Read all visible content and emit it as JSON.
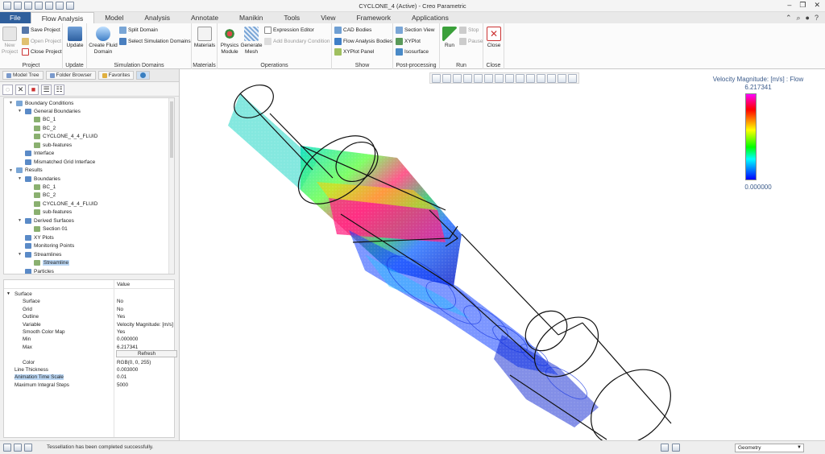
{
  "window": {
    "title": "CYCLONE_4 (Active) - Creo Parametric"
  },
  "tabs": [
    "File",
    "Flow Analysis",
    "Model",
    "Analysis",
    "Annotate",
    "Manikin",
    "Tools",
    "View",
    "Framework",
    "Applications"
  ],
  "active_tab": "Flow Analysis",
  "ribbon": {
    "project": {
      "label": "Project",
      "new": "New Project",
      "save": "Save Project",
      "open": "Open Project",
      "close": "Close Project"
    },
    "update": {
      "label": "Update",
      "button": "Update"
    },
    "simulation_domains": {
      "label": "Simulation Domains",
      "create_fluid": "Create Fluid Domain",
      "split": "Split Domain",
      "select": "Select Simulation Domains"
    },
    "materials": {
      "label": "Materials",
      "button": "Materials"
    },
    "operations": {
      "label": "Operations",
      "physics": "Physics Module",
      "mesh": "Generate Mesh",
      "expr": "Expression Editor",
      "add_bc": "Add Boundary Condition"
    },
    "show": {
      "label": "Show",
      "cad": "CAD Bodies",
      "fab": "Flow Analysis Bodies",
      "xyplot_panel": "XYPlot Panel"
    },
    "post": {
      "label": "Post-processing",
      "section_view": "Section View",
      "xyplot": "XYPlot",
      "isosurface": "Isosurface"
    },
    "run": {
      "label": "Run",
      "run": "Run",
      "stop": "Stop",
      "pause": "Pause"
    },
    "close": {
      "label": "Close",
      "button": "Close"
    }
  },
  "nav_tabs": [
    "Model Tree",
    "Folder Browser",
    "Favorites"
  ],
  "tree": [
    {
      "label": "Boundary Conditions",
      "level": 1,
      "exp": "-"
    },
    {
      "label": "General Boundaries",
      "level": 2,
      "exp": "-"
    },
    {
      "label": "BC_1",
      "level": 3,
      "exp": ""
    },
    {
      "label": "BC_2",
      "level": 3,
      "exp": ""
    },
    {
      "label": "CYCLONE_4_4_FLUID",
      "level": 3,
      "exp": ""
    },
    {
      "label": "sub-features",
      "level": 3,
      "exp": ""
    },
    {
      "label": "Interface",
      "level": 2,
      "exp": ""
    },
    {
      "label": "Mismatched Grid Interface",
      "level": 2,
      "exp": ""
    },
    {
      "label": "Results",
      "level": 1,
      "exp": "-"
    },
    {
      "label": "Boundaries",
      "level": 2,
      "exp": "-"
    },
    {
      "label": "BC_1",
      "level": 3,
      "exp": ""
    },
    {
      "label": "BC_2",
      "level": 3,
      "exp": ""
    },
    {
      "label": "CYCLONE_4_4_FLUID",
      "level": 3,
      "exp": ""
    },
    {
      "label": "sub-features",
      "level": 3,
      "exp": ""
    },
    {
      "label": "Derived Surfaces",
      "level": 2,
      "exp": "-"
    },
    {
      "label": "Section 01",
      "level": 3,
      "exp": ""
    },
    {
      "label": "XY Plots",
      "level": 2,
      "exp": ""
    },
    {
      "label": "Monitoring Points",
      "level": 2,
      "exp": ""
    },
    {
      "label": "Streamlines",
      "level": 2,
      "exp": "-"
    },
    {
      "label": "Streamline",
      "level": 3,
      "exp": "",
      "selected": true
    },
    {
      "label": "Particles",
      "level": 2,
      "exp": ""
    }
  ],
  "props": {
    "header": "Value",
    "rows": [
      {
        "k": "Surface",
        "v": "",
        "indent": 0,
        "exp": "-"
      },
      {
        "k": "Surface",
        "v": "No",
        "indent": 1
      },
      {
        "k": "Grid",
        "v": "No",
        "indent": 1
      },
      {
        "k": "Outline",
        "v": "Yes",
        "indent": 1
      },
      {
        "k": "Variable",
        "v": "Velocity Magnitude: [m/s] :",
        "indent": 1
      },
      {
        "k": "Smooth Color Map",
        "v": "Yes",
        "indent": 1
      },
      {
        "k": "Min",
        "v": "0.000000",
        "indent": 1
      },
      {
        "k": "Max",
        "v": "6.217341",
        "indent": 1
      },
      {
        "k": "",
        "v": "",
        "indent": 1
      },
      {
        "k": "Color",
        "v": "RGB(0, 0, 255)",
        "indent": 1
      },
      {
        "k": "Line Thickness",
        "v": "0.003000",
        "indent": 0
      },
      {
        "k": "Animation Time Scale",
        "v": "0.01",
        "indent": 0,
        "hl": true
      },
      {
        "k": "Maximum Integral Steps",
        "v": "5000",
        "indent": 0
      }
    ],
    "refresh": "Refresh"
  },
  "legend": {
    "title": "Velocity Magnitude: [m/s] : Flow",
    "max": "6.217341",
    "min": "0.000000"
  },
  "status": {
    "message": "Tessellation has been completed successfully.",
    "filter": "Geometry"
  },
  "colors": {
    "file_tab": "#2f5f9c",
    "legend_text": "#3a5a8a",
    "selection": "#bcd8f5"
  }
}
